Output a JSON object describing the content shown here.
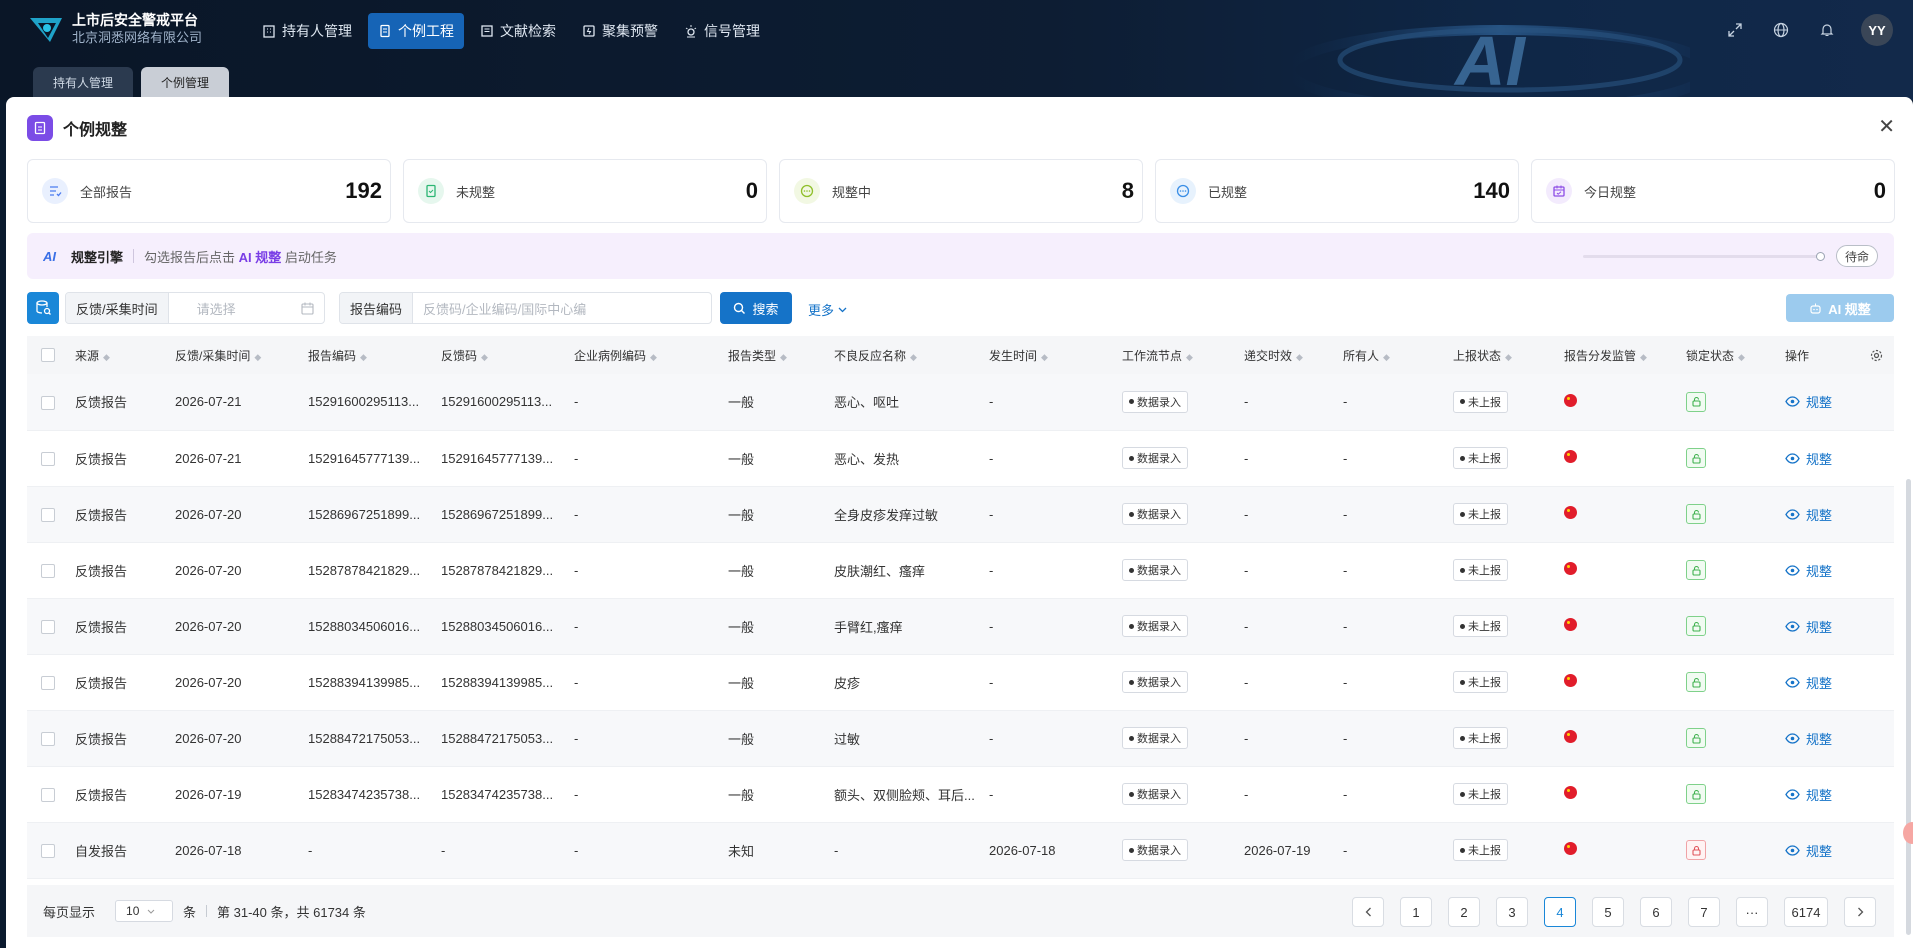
{
  "app": {
    "title": "上市后安全警戒平台",
    "subtitle": "北京洞悉网络有限公司",
    "user_initials": "YY"
  },
  "nav": [
    {
      "label": "持有人管理",
      "icon": "building-icon",
      "active": false
    },
    {
      "label": "个例工程",
      "icon": "document-icon",
      "active": true
    },
    {
      "label": "文献检索",
      "icon": "book-icon",
      "active": false
    },
    {
      "label": "聚集预警",
      "icon": "alert-icon",
      "active": false
    },
    {
      "label": "信号管理",
      "icon": "signal-icon",
      "active": false
    }
  ],
  "page_tabs": [
    {
      "label": "持有人管理",
      "active": false
    },
    {
      "label": "个例管理",
      "active": true
    }
  ],
  "card": {
    "title": "个例规整"
  },
  "stats": [
    {
      "label": "全部报告",
      "value": "192",
      "icon": "list-check-icon",
      "color": "#4c7cf0"
    },
    {
      "label": "未规整",
      "value": "0",
      "icon": "file-icon",
      "color": "#2bb673"
    },
    {
      "label": "规整中",
      "value": "8",
      "icon": "progress-icon",
      "color": "#8fbf2a"
    },
    {
      "label": "已规整",
      "value": "140",
      "icon": "done-icon",
      "color": "#3a8ee6"
    },
    {
      "label": "今日规整",
      "value": "0",
      "icon": "calendar-icon",
      "color": "#8d4ce6"
    }
  ],
  "engine": {
    "title": "规整引擎",
    "tip_prefix": "勾选报告后点击",
    "tip_action": "AI 规整",
    "tip_suffix": "启动任务",
    "status": "待命"
  },
  "filters": {
    "time_label": "反馈/采集时间",
    "time_placeholder": "请选择",
    "code_label": "报告编码",
    "code_placeholder": "反馈码/企业编码/国际中心编",
    "search": "搜索",
    "more": "更多",
    "ai_button": "AI 规整"
  },
  "table": {
    "columns": [
      "来源",
      "反馈/采集时间",
      "报告编码",
      "反馈码",
      "企业病例编码",
      "报告类型",
      "不良反应名称",
      "发生时间",
      "工作流节点",
      "递交时效",
      "所有人",
      "上报状态",
      "报告分发监管",
      "锁定状态",
      "操作"
    ],
    "rows": [
      {
        "source": "反馈报告",
        "time": "2026-07-21",
        "report_code": "15291600295113...",
        "feedback_code": "15291600295113...",
        "enterprise_code": "-",
        "type": "一般",
        "reaction": "恶心、呕吐",
        "occur": "-",
        "node": "数据录入",
        "deadline": "-",
        "owner": "-",
        "status": "未上报",
        "locked": false,
        "op": "规整"
      },
      {
        "source": "反馈报告",
        "time": "2026-07-21",
        "report_code": "15291645777139...",
        "feedback_code": "15291645777139...",
        "enterprise_code": "-",
        "type": "一般",
        "reaction": "恶心、发热",
        "occur": "-",
        "node": "数据录入",
        "deadline": "-",
        "owner": "-",
        "status": "未上报",
        "locked": false,
        "op": "规整"
      },
      {
        "source": "反馈报告",
        "time": "2026-07-20",
        "report_code": "15286967251899...",
        "feedback_code": "15286967251899...",
        "enterprise_code": "-",
        "type": "一般",
        "reaction": "全身皮疹发痒过敏",
        "occur": "-",
        "node": "数据录入",
        "deadline": "-",
        "owner": "-",
        "status": "未上报",
        "locked": false,
        "op": "规整"
      },
      {
        "source": "反馈报告",
        "time": "2026-07-20",
        "report_code": "15287878421829...",
        "feedback_code": "15287878421829...",
        "enterprise_code": "-",
        "type": "一般",
        "reaction": "皮肤潮红、瘙痒",
        "occur": "-",
        "node": "数据录入",
        "deadline": "-",
        "owner": "-",
        "status": "未上报",
        "locked": false,
        "op": "规整"
      },
      {
        "source": "反馈报告",
        "time": "2026-07-20",
        "report_code": "15288034506016...",
        "feedback_code": "15288034506016...",
        "enterprise_code": "-",
        "type": "一般",
        "reaction": "手臂红,瘙痒",
        "occur": "-",
        "node": "数据录入",
        "deadline": "-",
        "owner": "-",
        "status": "未上报",
        "locked": false,
        "op": "规整"
      },
      {
        "source": "反馈报告",
        "time": "2026-07-20",
        "report_code": "15288394139985...",
        "feedback_code": "15288394139985...",
        "enterprise_code": "-",
        "type": "一般",
        "reaction": "皮疹",
        "occur": "-",
        "node": "数据录入",
        "deadline": "-",
        "owner": "-",
        "status": "未上报",
        "locked": false,
        "op": "规整"
      },
      {
        "source": "反馈报告",
        "time": "2026-07-20",
        "report_code": "15288472175053...",
        "feedback_code": "15288472175053...",
        "enterprise_code": "-",
        "type": "一般",
        "reaction": "过敏",
        "occur": "-",
        "node": "数据录入",
        "deadline": "-",
        "owner": "-",
        "status": "未上报",
        "locked": false,
        "op": "规整"
      },
      {
        "source": "反馈报告",
        "time": "2026-07-19",
        "report_code": "15283474235738...",
        "feedback_code": "15283474235738...",
        "enterprise_code": "-",
        "type": "一般",
        "reaction": "额头、双侧脸颊、耳后...",
        "occur": "-",
        "node": "数据录入",
        "deadline": "-",
        "owner": "-",
        "status": "未上报",
        "locked": false,
        "op": "规整"
      },
      {
        "source": "自发报告",
        "time": "2026-07-18",
        "report_code": "-",
        "feedback_code": "-",
        "enterprise_code": "-",
        "type": "未知",
        "reaction": "-",
        "occur": "2026-07-18",
        "node": "数据录入",
        "deadline": "2026-07-19",
        "owner": "-",
        "status": "未上报",
        "locked": true,
        "op": "规整"
      }
    ]
  },
  "footer": {
    "per_page_label": "每页显示",
    "per_page": "10",
    "unit": "条",
    "range": "第 31-40 条，共 61734 条",
    "pages": [
      "1",
      "2",
      "3",
      "4",
      "5",
      "6",
      "7",
      "···",
      "6174"
    ],
    "current_page": "4"
  }
}
